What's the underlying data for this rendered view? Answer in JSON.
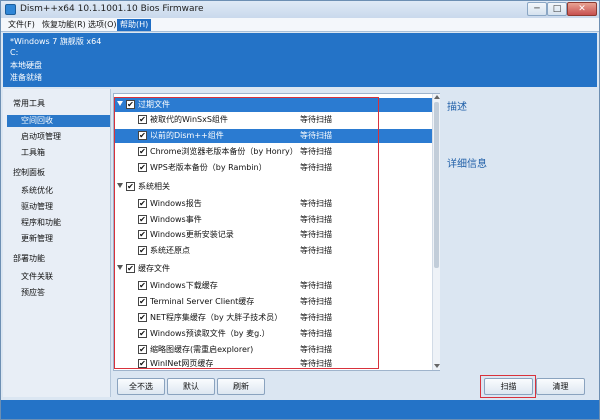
{
  "window": {
    "title": "Dism++x64 10.1.1001.10 Bios Firmware",
    "minimize": "─",
    "maximize": "□",
    "close": "✕"
  },
  "menu": [
    {
      "label": "文件(F)",
      "active": false
    },
    {
      "label": "恢复功能(R)",
      "active": false
    },
    {
      "label": "选项(O)",
      "active": false
    },
    {
      "label": "帮助(H)",
      "active": true
    }
  ],
  "info": {
    "os": "*Windows 7 旗舰版 x64",
    "drive": "C:",
    "disk": "本地硬盘",
    "status": "准备就绪"
  },
  "sidebar": [
    {
      "label": "常用工具",
      "level": 0,
      "active": false
    },
    {
      "label": "空间回收",
      "level": 1,
      "active": true
    },
    {
      "label": "启动项管理",
      "level": 1,
      "active": false
    },
    {
      "label": "工具箱",
      "level": 1,
      "active": false
    },
    {
      "label": "控制面板",
      "level": 0,
      "active": false
    },
    {
      "label": "系统优化",
      "level": 1,
      "active": false
    },
    {
      "label": "驱动管理",
      "level": 1,
      "active": false
    },
    {
      "label": "程序和功能",
      "level": 1,
      "active": false
    },
    {
      "label": "更新管理",
      "level": 1,
      "active": false
    },
    {
      "label": "部署功能",
      "level": 0,
      "active": false
    },
    {
      "label": "文件关联",
      "level": 1,
      "active": false
    },
    {
      "label": "预应答",
      "level": 1,
      "active": false
    }
  ],
  "list": {
    "groups": [
      {
        "label": "过期文件",
        "checked": true,
        "items": [
          {
            "label": "被取代的WinSxS组件",
            "status": "等待扫描",
            "checked": true,
            "selected": false
          },
          {
            "label": "以前的Dism++组件",
            "status": "等待扫描",
            "checked": true,
            "selected": true
          },
          {
            "label": "Chrome浏览器老版本备份（by Honry）",
            "status": "等待扫描",
            "checked": true,
            "selected": false
          },
          {
            "label": "WPS老版本备份（by Rambin）",
            "status": "等待扫描",
            "checked": true,
            "selected": false
          }
        ]
      },
      {
        "label": "系统相关",
        "checked": true,
        "items": [
          {
            "label": "Windows报告",
            "status": "等待扫描",
            "checked": true,
            "selected": false
          },
          {
            "label": "Windows事件",
            "status": "等待扫描",
            "checked": true,
            "selected": false
          },
          {
            "label": "Windows更新安装记录",
            "status": "等待扫描",
            "checked": true,
            "selected": false
          },
          {
            "label": "系统还原点",
            "status": "等待扫描",
            "checked": true,
            "selected": false
          }
        ]
      },
      {
        "label": "缓存文件",
        "checked": true,
        "items": [
          {
            "label": "Windows下载缓存",
            "status": "等待扫描",
            "checked": true,
            "selected": false
          },
          {
            "label": "Terminal Server Client缓存",
            "status": "等待扫描",
            "checked": true,
            "selected": false
          },
          {
            "label": "NET程序集缓存（by 大胖子技术员）",
            "status": "等待扫描",
            "checked": true,
            "selected": false
          },
          {
            "label": "Windows预读取文件（by 麦g.）",
            "status": "等待扫描",
            "checked": true,
            "selected": false
          },
          {
            "label": "缩略图缓存(需重启explorer)",
            "status": "等待扫描",
            "checked": true,
            "selected": false
          },
          {
            "label": "WinINet网页缓存",
            "status": "等待扫描",
            "checked": true,
            "selected": false
          }
        ]
      }
    ]
  },
  "right": {
    "description": "描述",
    "details": "详细信息"
  },
  "buttons": {
    "unselect_all": "全不选",
    "default": "默认",
    "refresh": "刷新",
    "scan": "扫描",
    "clean": "清理"
  },
  "icons": {
    "app": "dism-app-icon",
    "checkmark": "✔"
  },
  "colors": {
    "accent": "#2473c7",
    "selection": "#2b7bd1",
    "highlight": "#d8323c",
    "heading": "#1f5fa8"
  }
}
